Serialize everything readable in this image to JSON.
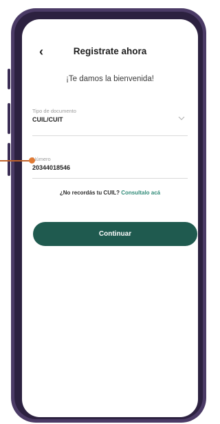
{
  "header": {
    "back_icon": "chevron-left-icon",
    "title": "Registrate ahora"
  },
  "welcome": "¡Te damos la bienvenida!",
  "document_type": {
    "label": "Tipo de documento",
    "value": "CUIL/CUIT",
    "icon": "chevron-down-icon"
  },
  "number": {
    "label": "Número",
    "value": "20344018546"
  },
  "hint": {
    "text": "¿No recordás tu CUIL?",
    "link": "Consultalo acá"
  },
  "continue_label": "Continuar",
  "colors": {
    "primary": "#1f5a4f",
    "link": "#2f8a77",
    "frame": "#4b3b66",
    "annotation": "#e07a34"
  }
}
